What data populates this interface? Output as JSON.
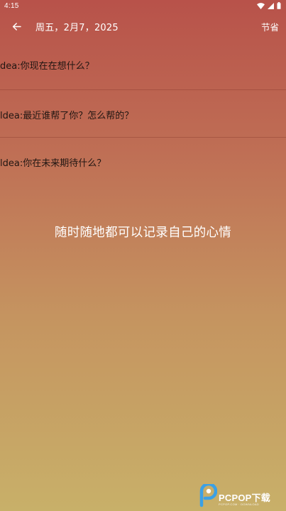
{
  "status_bar": {
    "time": "4:15"
  },
  "app_bar": {
    "title": "周五，2月7，2025",
    "save_label": "节省"
  },
  "questions": [
    {
      "text": "dea:你现在在想什么？"
    },
    {
      "text": "ldea:最近谁帮了你？怎么帮的？"
    },
    {
      "text": "ldea:你在未来期待什么？"
    }
  ],
  "caption": "随时随地都可以记录自己的心情",
  "watermark": {
    "brand": "PCPOP下载",
    "sub": "PCPOP.COM · DOWNLOAD"
  },
  "colors": {
    "gradient_top": "#b8524a",
    "gradient_bottom": "#c8b069",
    "text": "#211612"
  }
}
